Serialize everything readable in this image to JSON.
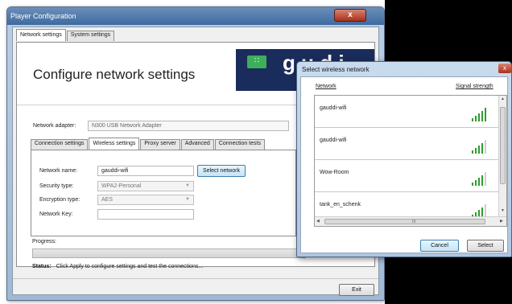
{
  "main_window": {
    "title": "Player Configuration",
    "close_glyph": "x",
    "tabs": [
      {
        "label": "Network settings",
        "active": true
      },
      {
        "label": "System settings",
        "active": false
      }
    ],
    "header_title": "Configure network settings",
    "brand_icon": "network-icon",
    "brand_text": "g u d i"
  },
  "adapter": {
    "label": "Network adapter:",
    "value": "N300 USB Network Adapter"
  },
  "inner_tabs": [
    {
      "label": "Connection settings",
      "active": false
    },
    {
      "label": "Wireless settings",
      "active": true
    },
    {
      "label": "Proxy server",
      "active": false
    },
    {
      "label": "Advanced",
      "active": false
    },
    {
      "label": "Connection tests",
      "active": false
    }
  ],
  "wireless": {
    "name_label": "Network name:",
    "name_value": "gauddi-wifi",
    "select_button": "Select network",
    "security_label": "Security type:",
    "security_value": "WPA2-Personal",
    "encryption_label": "Encryption type:",
    "encryption_value": "AES",
    "key_label": "Network Key:",
    "key_value": ""
  },
  "progress": {
    "label": "Progress:"
  },
  "status": {
    "label": "Status:",
    "text": "Click Apply to configure settings and test the connections..."
  },
  "footer": {
    "exit_button": "Exit"
  },
  "dialog": {
    "title": "Select wireless network",
    "close_glyph": "x",
    "col_network": "Network",
    "col_signal": "Signal strength",
    "networks": [
      {
        "name": "gauddi-wifi",
        "bars": 5
      },
      {
        "name": "gauddi-wifi",
        "bars": 4
      },
      {
        "name": "Wow-Room",
        "bars": 4
      },
      {
        "name": "tank_en_schenk",
        "bars": 4
      }
    ],
    "hscroll_grip": "III",
    "cancel_button": "Cancel",
    "select_button": "Select"
  },
  "colors": {
    "signal_on": "#2e9e2e",
    "signal_off": "#cfcfcf",
    "brand_bg": "#1a2c5c",
    "brand_icon": "#3fae5b"
  }
}
